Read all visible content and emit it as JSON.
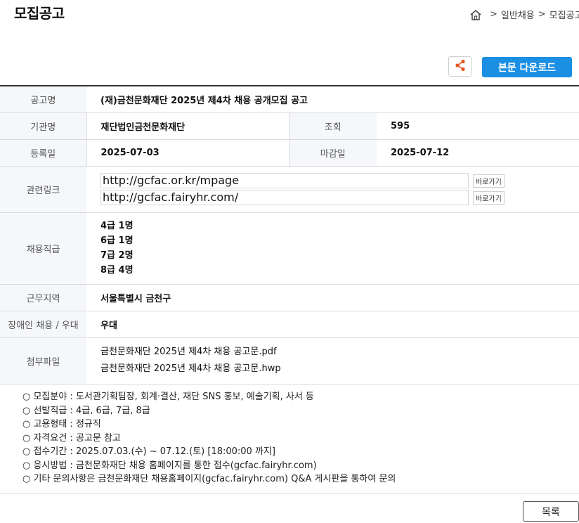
{
  "header": {
    "title": "모집공고",
    "breadcrumb": [
      "일반채용",
      "모집공고"
    ],
    "breadcrumb_sep": ">"
  },
  "toolbar": {
    "download_label": "본문 다운로드"
  },
  "labels": {
    "title": "공고명",
    "org": "기관명",
    "views": "조회",
    "reg": "등록일",
    "deadline": "마감일",
    "links": "관련링크",
    "positions": "채용직급",
    "location": "근무지역",
    "disability": "장애인 채용 / 우대",
    "files": "첨부파일"
  },
  "values": {
    "title": "(재)금천문화재단 2025년 제4차 채용 공개모집 공고",
    "org": "재단법인금천문화재단",
    "views": "595",
    "reg": "2025-07-03",
    "deadline": "2025-07-12",
    "location": "서울특별시 금천구",
    "disability": "우대"
  },
  "links": [
    {
      "url": "http://gcfac.or.kr/mpage",
      "button": "바로가기"
    },
    {
      "url": "http://gcfac.fairyhr.com/",
      "button": "바로가기"
    }
  ],
  "positions": [
    "4급 1명",
    "6급 1명",
    "7급 2명",
    "8급 4명"
  ],
  "files": [
    "금천문화재단 2025년 제4차 채용 공고문.pdf",
    "금천문화재단 2025년 제4차 채용 공고문.hwp"
  ],
  "notice": [
    "○ 모집분야 : 도서관기획팀장, 회계·결산, 재단 SNS 홍보, 예술기획, 사서 등",
    "○ 선발직급 : 4급, 6급, 7급, 8급",
    "○ 고용형태 : 정규직",
    "○ 자격요건 : 공고문 참고",
    "○ 접수기간 : 2025.07.03.(수) ~ 07.12.(토) [18:00:00 까지]",
    "○ 응시방법 : 금천문화재단 채용 홈페이지를 통한 접수(gcfac.fairyhr.com)",
    " ○ 기타 문의사항은 금천문화재단 채용홈페이지(gcfac.fairyhr.com) Q&A 게시판을 통하여 문의"
  ],
  "footer": {
    "list_label": "목록"
  },
  "colors": {
    "accent": "#1a8fe3",
    "share": "#e8541e",
    "header_bg": "#f5f7fa"
  },
  "icons": {
    "home": "home-icon",
    "share": "share-icon"
  }
}
